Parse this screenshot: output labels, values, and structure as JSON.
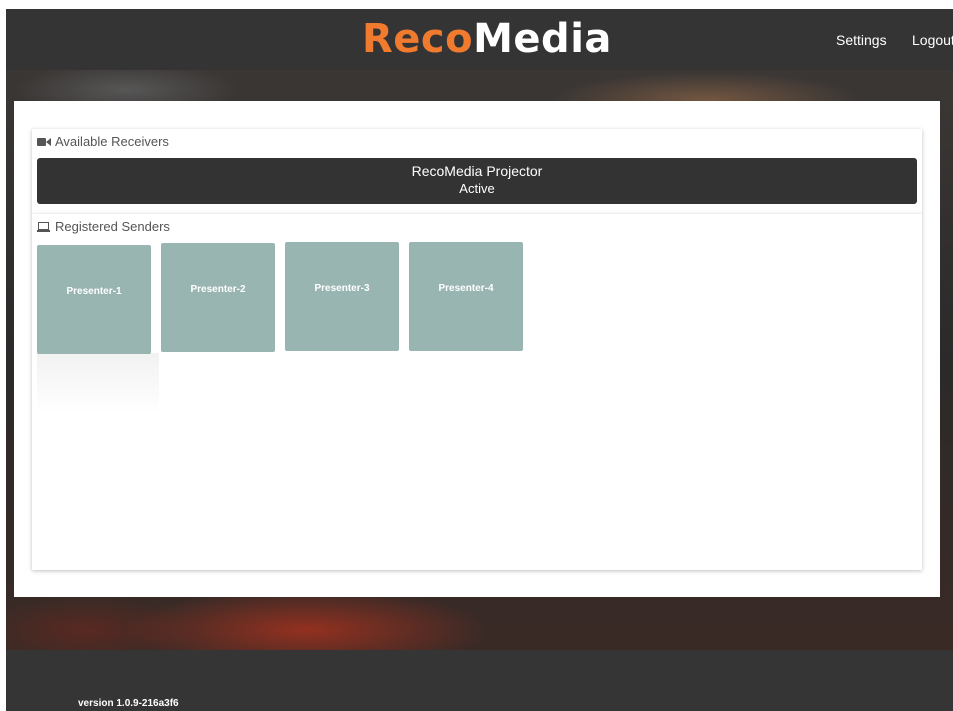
{
  "header": {
    "logo_part1": "Reco",
    "logo_part2": "Media",
    "settings_label": "Settings",
    "logout_label": "Logout"
  },
  "receivers": {
    "title": "Available Receivers",
    "icon": "video-camera-icon",
    "items": [
      {
        "name": "RecoMedia Projector",
        "status": "Active"
      }
    ]
  },
  "senders": {
    "title": "Registered Senders",
    "icon": "laptop-icon",
    "items": [
      {
        "label": "Presenter-1"
      },
      {
        "label": "Presenter-2"
      },
      {
        "label": "Presenter-3"
      },
      {
        "label": "Presenter-4"
      }
    ]
  },
  "footer": {
    "version": "version 1.0.9-216a3f6"
  },
  "colors": {
    "brand_orange": "#f07b2e",
    "header_bg": "#343434",
    "receiver_bg": "#333333",
    "sender_tile": "#98b5b2"
  }
}
